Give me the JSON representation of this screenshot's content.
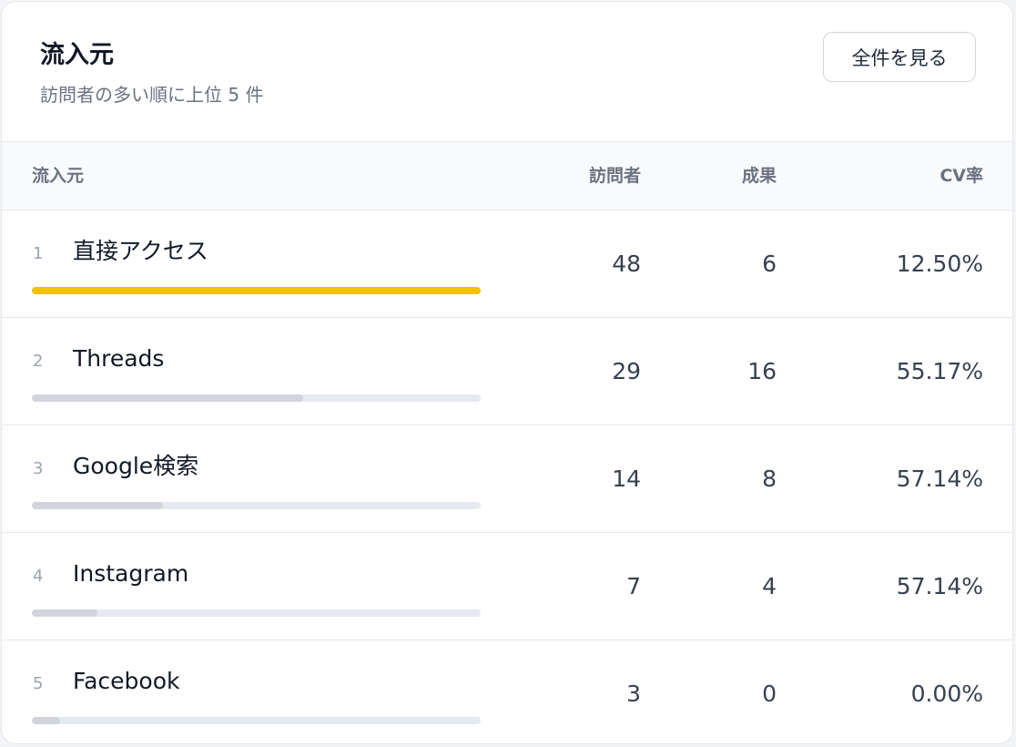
{
  "panel": {
    "title": "流入元",
    "subtitle": "訪問者の多い順に上位 5 件",
    "view_all_label": "全件を見る"
  },
  "table": {
    "columns": {
      "source": "流入元",
      "visitors": "訪問者",
      "results": "成果",
      "cv_rate": "CV率"
    },
    "rows": [
      {
        "rank": "1",
        "name": "直接アクセス",
        "visitors": "48",
        "results": "6",
        "cv_rate": "12.50%",
        "share_of_max": 1.0
      },
      {
        "rank": "2",
        "name": "Threads",
        "visitors": "29",
        "results": "16",
        "cv_rate": "55.17%",
        "share_of_max": 0.604
      },
      {
        "rank": "3",
        "name": "Google検索",
        "visitors": "14",
        "results": "8",
        "cv_rate": "57.14%",
        "share_of_max": 0.292
      },
      {
        "rank": "4",
        "name": "Instagram",
        "visitors": "7",
        "results": "4",
        "cv_rate": "57.14%",
        "share_of_max": 0.146
      },
      {
        "rank": "5",
        "name": "Facebook",
        "visitors": "3",
        "results": "0",
        "cv_rate": "0.00%",
        "share_of_max": 0.0625
      }
    ]
  },
  "colors": {
    "top_bar": "#f2c200",
    "other_bar": "#d1d5db",
    "bar_track": "#e5e9f0"
  }
}
